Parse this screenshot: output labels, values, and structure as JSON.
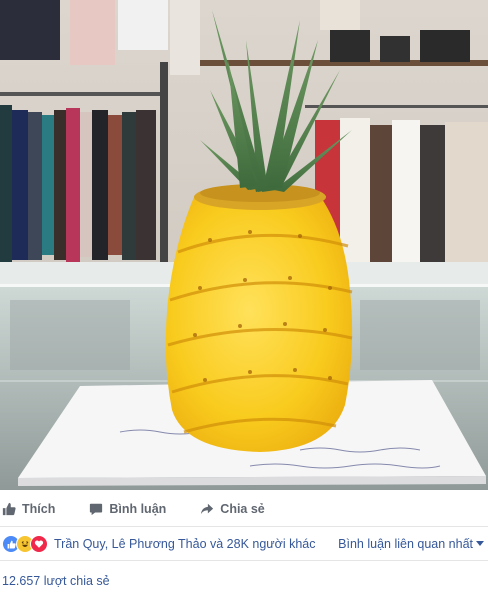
{
  "post": {
    "actions": {
      "like_label": "Thích",
      "comment_label": "Bình luận",
      "share_label": "Chia sẻ"
    },
    "reactions": {
      "icons": [
        "like-icon",
        "haha-icon",
        "love-icon"
      ],
      "likers_text": "Trần Quy, Lê Phương Thảo và 28K người khác",
      "sort_label": "Bình luận liên quan nhất"
    },
    "shares_text": "12.657 lượt chia sẻ"
  },
  "colors": {
    "link": "#365899",
    "muted": "#606770",
    "like_blue": "#4b8af7",
    "haha_yellow": "#f7c531",
    "love_red": "#f0284a"
  }
}
